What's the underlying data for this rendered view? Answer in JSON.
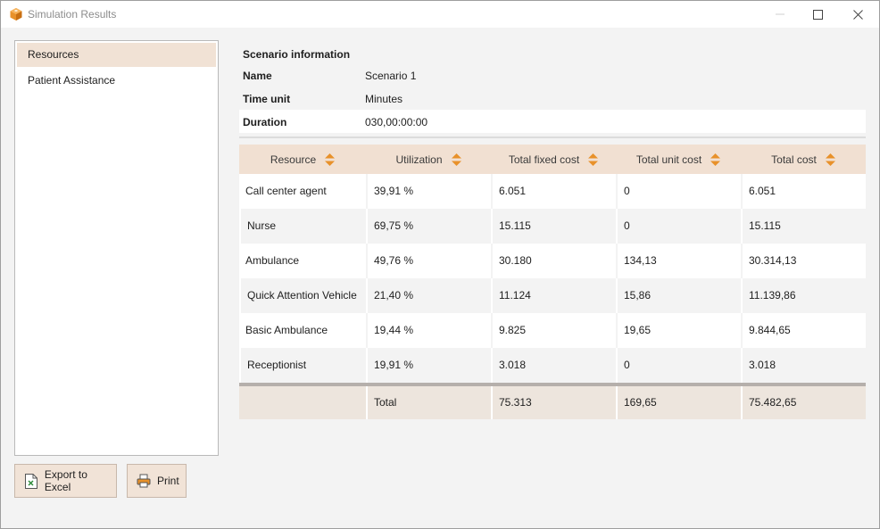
{
  "window": {
    "title": "Simulation Results",
    "accent": "#e8912a"
  },
  "nav": {
    "items": [
      {
        "label": "Resources",
        "active": true
      },
      {
        "label": "Patient Assistance",
        "active": false
      }
    ]
  },
  "actions": {
    "export_label": "Export to Excel",
    "print_label": "Print"
  },
  "scenario": {
    "heading": "Scenario information",
    "rows": [
      {
        "label": "Name",
        "value": "Scenario 1"
      },
      {
        "label": "Time unit",
        "value": "Minutes"
      },
      {
        "label": "Duration",
        "value": "030,00:00:00"
      }
    ]
  },
  "table": {
    "columns": [
      "Resource",
      "Utilization",
      "Total fixed cost",
      "Total unit cost",
      "Total cost"
    ],
    "rows": [
      [
        "Call center agent",
        "39,91 %",
        "6.051",
        "0",
        "6.051"
      ],
      [
        "Nurse",
        "69,75 %",
        "15.115",
        "0",
        "15.115"
      ],
      [
        "Ambulance",
        "49,76 %",
        "30.180",
        "134,13",
        "30.314,13"
      ],
      [
        "Quick Attention Vehicle",
        "21,40 %",
        "11.124",
        "15,86",
        "11.139,86"
      ],
      [
        "Basic Ambulance",
        "19,44 %",
        "9.825",
        "19,65",
        "9.844,65"
      ],
      [
        "Receptionist",
        "19,91 %",
        "3.018",
        "0",
        "3.018"
      ]
    ],
    "total": [
      "",
      "Total",
      "75.313",
      "169,65",
      "75.482,65"
    ]
  },
  "icons": {
    "app": "cube-icon",
    "minimize": "minimize-icon",
    "maximize": "maximize-icon",
    "close": "close-icon",
    "excel": "excel-file-icon",
    "print": "printer-icon",
    "sort": "sort-icon"
  }
}
